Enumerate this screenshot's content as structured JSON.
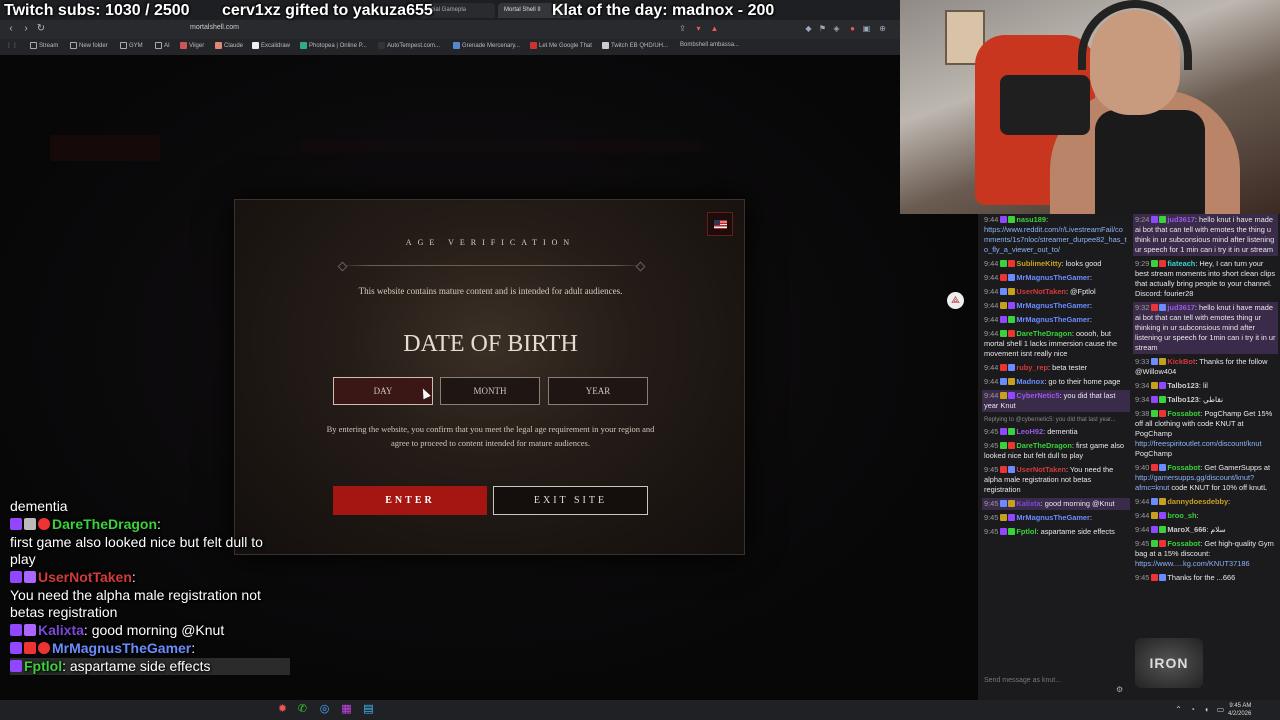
{
  "overlay": {
    "subs": "Twitch subs: 1030 / 2500",
    "gifted": "cerv1xz gifted to yakuza655",
    "klat": "Klat of the day: madnox - 200"
  },
  "browser": {
    "tabs": [
      {
        "label": "...cial Gamepla",
        "active": false
      },
      {
        "label": "Mortal Shell II",
        "active": true
      }
    ],
    "url": "mortalshell.com",
    "bookmarks": [
      "Stream",
      "New folder",
      "GYM",
      "AI",
      "Viiger",
      "Claude",
      "Excalidraw",
      "Photopea | Online P...",
      "AutoTempest.com...",
      "Grenade Mercenary...",
      "Let Me Google That",
      "Twitch EB QHD/UH...",
      "Bombshell ambassa..."
    ]
  },
  "modal": {
    "title": "AGE VERIFICATION",
    "description": "This website contains mature content and is intended for adult audiences.",
    "dob_title": "DATE OF BIRTH",
    "fields": {
      "day": "DAY",
      "month": "MONTH",
      "year": "YEAR"
    },
    "legal": "By entering the website, you confirm that you meet the legal age requirement in your region and agree to proceed to content intended for mature audiences.",
    "enter": "ENTER",
    "exit": "EXIT SITE",
    "flag_icon": "us-flag-icon"
  },
  "overlay_chat": [
    {
      "user": "",
      "text": "dementia",
      "color": "#ffffff"
    },
    {
      "user": "DareTheDragon",
      "text": ":",
      "color": "#3ad13a"
    },
    {
      "user": "",
      "text": "first game also looked nice but felt dull to play",
      "color": "#ffffff"
    },
    {
      "user": "UserNotTaken",
      "text": ":",
      "color": "#d43a3a"
    },
    {
      "user": "",
      "text": "You need the alpha male registration not betas registration",
      "color": "#ffffff"
    },
    {
      "user": "Kalixta",
      "text": ": good morning @Knut",
      "color": "#7a4ad8"
    },
    {
      "user": "MrMagnusTheGamer",
      "text": ":",
      "color": "#6a8cff"
    },
    {
      "user": "Fptlol",
      "text": ": aspartame side effects",
      "color": "#3ad13a"
    }
  ],
  "chat_left": [
    {
      "ts": "9:44",
      "user": "nasu189",
      "color": "#3ad13a",
      "text": ": ",
      "link": "https://www.reddit.com/r/LivestreamFail/comments/1s7nloc/streamer_durpee82_has_to_fly_a_viewer_out_to/"
    },
    {
      "ts": "9:44",
      "user": "SublimeKitty",
      "color": "#c8a020",
      "text": ": looks good",
      "link": ""
    },
    {
      "ts": "9:44",
      "user": "MrMagnusTheGamer",
      "color": "#6a8cff",
      "text": ":",
      "link": ""
    },
    {
      "ts": "9:44",
      "user": "UserNotTaken",
      "color": "#d43a3a",
      "text": ": @Fptlol",
      "link": ""
    },
    {
      "ts": "9:44",
      "user": "MrMagnusTheGamer",
      "color": "#6a8cff",
      "text": ":",
      "link": ""
    },
    {
      "ts": "9:44",
      "user": "MrMagnusTheGamer",
      "color": "#6a8cff",
      "text": ":",
      "link": ""
    },
    {
      "ts": "9:44",
      "user": "DareTheDragon",
      "color": "#3ad13a",
      "text": ": ooooh, but mortal shell 1 lacks immersion cause the movement isnt really nice",
      "link": ""
    },
    {
      "ts": "9:44",
      "user": "ruby_rep",
      "color": "#d43a3a",
      "text": ": beta tester",
      "link": ""
    },
    {
      "ts": "9:44",
      "user": "Madnox",
      "color": "#6a8cff",
      "text": ": go to their home page",
      "link": ""
    },
    {
      "ts": "9:44",
      "user": "CyberNetic5",
      "color": "#9a5ae8",
      "text": ": you did that last year Knut",
      "link": "",
      "hl": true
    },
    {
      "ts": "9:45",
      "user": "LeoH92",
      "color": "#9a5ae8",
      "text": ": dementia",
      "link": "",
      "reply": "Replying to @cybernetic5: you did that last year..."
    },
    {
      "ts": "9:45",
      "user": "DareTheDragon",
      "color": "#3ad13a",
      "text": ": first game also looked nice but felt dull to play",
      "link": ""
    },
    {
      "ts": "9:45",
      "user": "UserNotTaken",
      "color": "#d43a3a",
      "text": ": You need the alpha male registration not betas registration",
      "link": ""
    },
    {
      "ts": "9:45",
      "user": "Kalixta",
      "color": "#7a4ad8",
      "text": ": good morning @Knut",
      "link": "",
      "hl": true
    },
    {
      "ts": "9:45",
      "user": "MrMagnusTheGamer",
      "color": "#6a8cff",
      "text": ":",
      "link": ""
    },
    {
      "ts": "9:45",
      "user": "Fptlol",
      "color": "#3ad13a",
      "text": ": aspartame side effects",
      "link": ""
    }
  ],
  "chat_right": [
    {
      "ts": "9:24",
      "user": "jud3617",
      "color": "#9a5ae8",
      "text": ": hello knut i have made ai bot that can tell with emotes the thing u think in ur subconsious mind after listening ur speech for 1 min can i try it in ur stream",
      "link": "",
      "hl": true
    },
    {
      "ts": "9:29",
      "user": "fiateach",
      "color": "#3ad1d1",
      "text": ": Hey, I can turn your best stream moments into short clean clips that actually bring people to your channel. Discord: fourier28",
      "link": ""
    },
    {
      "ts": "9:32",
      "user": "jud3617",
      "color": "#9a5ae8",
      "text": ": hello knut i have made ai bot that can tell with emotes thing ur thinking in ur subconsious mind after listening ur speech for 1min can i try it in ur stream",
      "link": "",
      "hl": true
    },
    {
      "ts": "9:33",
      "user": "KickBot",
      "color": "#d43a3a",
      "text": ": Thanks for the follow @Willow404",
      "link": ""
    },
    {
      "ts": "9:34",
      "user": "Talbo123",
      "color": "#cccccc",
      "text": ": lil",
      "link": ""
    },
    {
      "ts": "9:34",
      "user": "Talbo123",
      "color": "#cccccc",
      "text": ": نقاطي",
      "link": ""
    },
    {
      "ts": "9:38",
      "user": "Fossabot",
      "color": "#3ad13a",
      "text": ": PogChamp Get 15% off all clothing with code KNUT at PogChamp",
      "link": "http://freespiritoutlet.com/discount/knut",
      "tail": " PogChamp"
    },
    {
      "ts": "9:40",
      "user": "Fossabot",
      "color": "#3ad13a",
      "text": ": Get GamerSupps at",
      "link": "http://gamersupps.gg/discount/knut?afmc=knut",
      "tail": " code KNUT for 10% off knutL"
    },
    {
      "ts": "9:44",
      "user": "dannydoesdebby",
      "color": "#c8a020",
      "text": ":",
      "link": ""
    },
    {
      "ts": "9:44",
      "user": "broo_sh",
      "color": "#3ad13a",
      "text": ":",
      "link": ""
    },
    {
      "ts": "9:44",
      "user": "MaroX_666",
      "color": "#cccccc",
      "text": ": سلام",
      "link": ""
    },
    {
      "ts": "9:45",
      "user": "Fossabot",
      "color": "#3ad13a",
      "text": ": Get high-quality Gym bag at a 15% discount:",
      "link": "https://www.....kg.com/KNUT37186",
      "tail": ""
    },
    {
      "ts": "9:45",
      "user": "",
      "color": "#cccccc",
      "text": "Thanks for the ...666",
      "link": ""
    }
  ],
  "chat": {
    "input_placeholder": "Send message as knut...",
    "logo": "IRON"
  },
  "taskbar": {
    "time": "9:45 AM",
    "date": "4/2/2026"
  }
}
